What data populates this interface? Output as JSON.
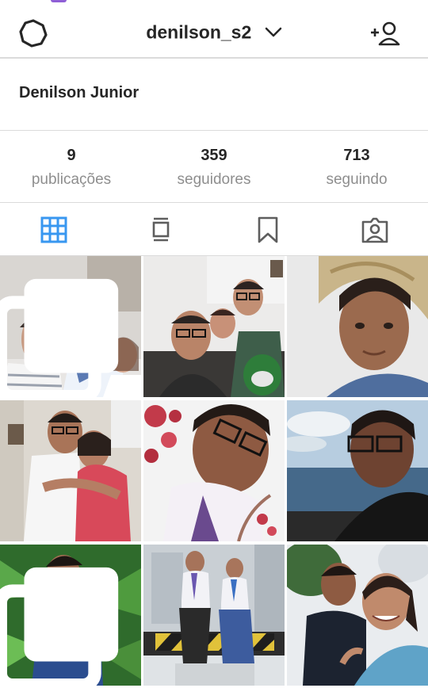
{
  "header": {
    "username": "denilson_s2",
    "settings_icon": "settings-gear-icon",
    "dropdown_icon": "chevron-down-icon",
    "add_user_icon": "add-user-icon"
  },
  "profile": {
    "full_name": "Denilson Junior"
  },
  "stats": [
    {
      "value": "9",
      "label": "publicações"
    },
    {
      "value": "359",
      "label": "seguidores"
    },
    {
      "value": "713",
      "label": "seguindo"
    }
  ],
  "tabs": [
    {
      "name": "grid-view",
      "icon": "grid-icon",
      "active": true
    },
    {
      "name": "feed-view",
      "icon": "feed-icon",
      "active": false
    },
    {
      "name": "saved",
      "icon": "bookmark-icon",
      "active": false
    },
    {
      "name": "tagged",
      "icon": "tagged-user-icon",
      "active": false
    }
  ],
  "colors": {
    "accent": "#3897f0",
    "icon": "#5e5e5e",
    "divider": "#dbdbdb",
    "muted": "#8e8e8e"
  },
  "posts": [
    {
      "description": "selfie-family-three",
      "multi": true
    },
    {
      "description": "selfie-group-with-gift",
      "multi": false
    },
    {
      "description": "selfie-straw-hat",
      "multi": false
    },
    {
      "description": "hug-with-mother",
      "multi": false
    },
    {
      "description": "selfie-with-flowers",
      "multi": false
    },
    {
      "description": "selfie-by-the-sea",
      "multi": false
    },
    {
      "description": "portrait-in-garden",
      "multi": true
    },
    {
      "description": "two-boys-seated",
      "multi": false
    },
    {
      "description": "selfie-with-friend",
      "multi": false
    }
  ]
}
